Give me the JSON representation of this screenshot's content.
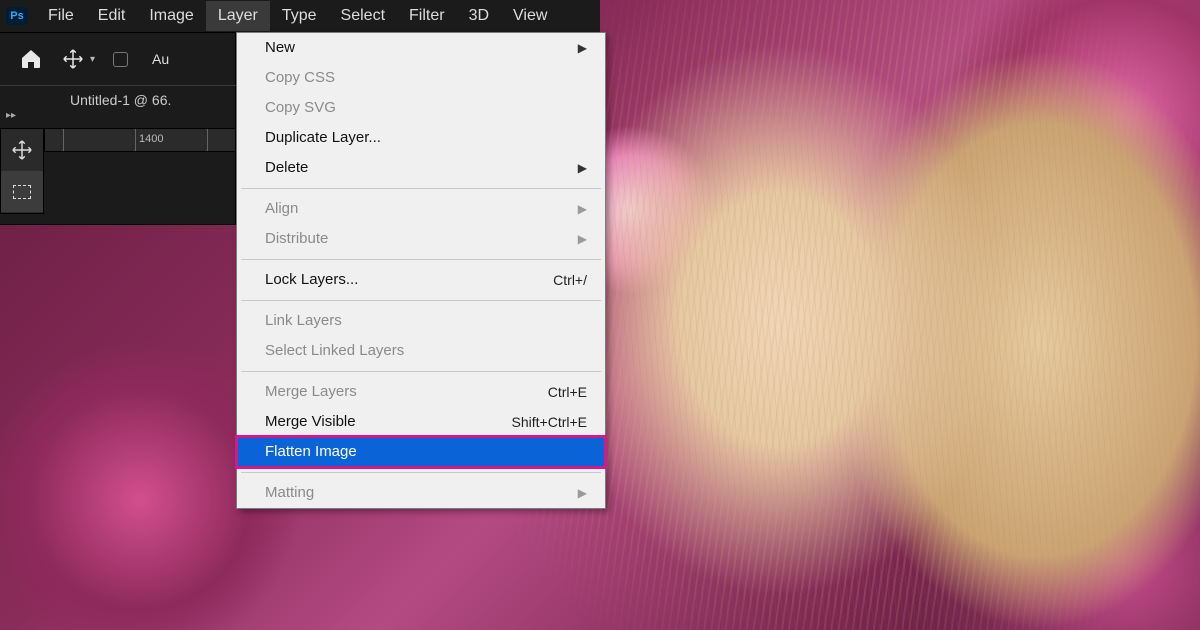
{
  "app": {
    "logo_text": "Ps"
  },
  "menu": {
    "items": [
      "File",
      "Edit",
      "Image",
      "Layer",
      "Type",
      "Select",
      "Filter",
      "3D",
      "View"
    ],
    "active_index": 3
  },
  "options": {
    "auto_label_fragment": "Au"
  },
  "document": {
    "tab_label": "Untitled-1 @ 66."
  },
  "ruler": {
    "mark_a": "1400"
  },
  "dropdown": {
    "groups": [
      [
        {
          "label": "New",
          "enabled": true,
          "submenu": true
        },
        {
          "label": "Copy CSS",
          "enabled": false
        },
        {
          "label": "Copy SVG",
          "enabled": false
        },
        {
          "label": "Duplicate Layer...",
          "enabled": true
        },
        {
          "label": "Delete",
          "enabled": true,
          "submenu": true
        }
      ],
      [
        {
          "label": "Align",
          "enabled": false,
          "submenu": true
        },
        {
          "label": "Distribute",
          "enabled": false,
          "submenu": true
        }
      ],
      [
        {
          "label": "Lock Layers...",
          "enabled": true,
          "shortcut": "Ctrl+/"
        }
      ],
      [
        {
          "label": "Link Layers",
          "enabled": false
        },
        {
          "label": "Select Linked Layers",
          "enabled": false
        }
      ],
      [
        {
          "label": "Merge Layers",
          "enabled": false,
          "shortcut": "Ctrl+E"
        },
        {
          "label": "Merge Visible",
          "enabled": true,
          "shortcut": "Shift+Ctrl+E"
        },
        {
          "label": "Flatten Image",
          "enabled": true,
          "highlight": true
        }
      ],
      [
        {
          "label": "Matting",
          "enabled": false,
          "submenu": true
        }
      ]
    ]
  }
}
